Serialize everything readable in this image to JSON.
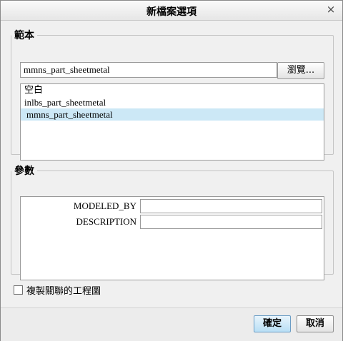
{
  "window": {
    "title": "新檔案選項",
    "close_glyph": "×"
  },
  "template": {
    "legend": "範本",
    "input_value": "mmns_part_sheetmetal",
    "browse_label": "瀏覽...",
    "list_items": [
      "空白",
      "inlbs_part_sheetmetal",
      "mmns_part_sheetmetal"
    ],
    "selected_index": 2
  },
  "parameters": {
    "legend": "參數",
    "rows": [
      {
        "label": "MODELED_BY",
        "value": ""
      },
      {
        "label": "DESCRIPTION",
        "value": ""
      }
    ]
  },
  "copy_drawings": {
    "label": "複製關聯的工程圖",
    "checked": false
  },
  "buttons": {
    "ok": "確定",
    "cancel": "取消"
  },
  "colors": {
    "selection": "#cce8f6",
    "ok_button": "#b9dff5"
  }
}
